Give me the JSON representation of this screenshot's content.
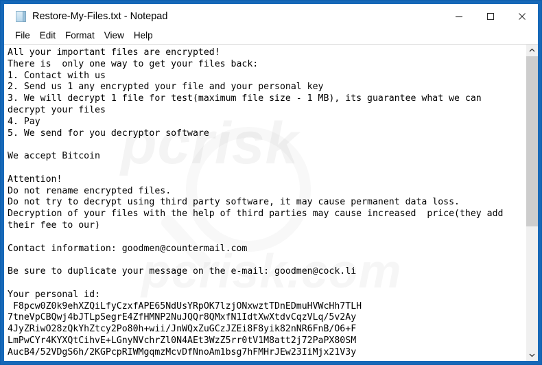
{
  "window": {
    "title": "Restore-My-Files.txt - Notepad",
    "icon": "notepad-document-icon",
    "accent_color": "#1668b8",
    "client_background": "#ffffff"
  },
  "caption_buttons": [
    {
      "name": "minimize",
      "glyph": "—",
      "label": "Minimize"
    },
    {
      "name": "maximize",
      "glyph": "□",
      "label": "Maximize"
    },
    {
      "name": "close",
      "glyph": "✕",
      "label": "Close"
    }
  ],
  "menubar": {
    "items": [
      {
        "label": "File"
      },
      {
        "label": "Edit"
      },
      {
        "label": "Format"
      },
      {
        "label": "View"
      },
      {
        "label": "Help"
      }
    ]
  },
  "document": {
    "filename": "Restore-My-Files.txt",
    "lines": [
      "All your important files are encrypted!",
      "There is  only one way to get your files back:",
      "1. Contact with us",
      "2. Send us 1 any encrypted your file and your personal key",
      "3. We will decrypt 1 file for test(maximum file size - 1 MB), its guarantee what we can",
      "decrypt your files",
      "4. Pay",
      "5. We send for you decryptor software",
      "",
      "We accept Bitcoin",
      "",
      "Attention!",
      "Do not rename encrypted files.",
      "Do not try to decrypt using third party software, it may cause permanent data loss.",
      "Decryption of your files with the help of third parties may cause increased  price(they add",
      "their fee to our)",
      "",
      "Contact information: goodmen@countermail.com",
      "",
      "Be sure to duplicate your message on the e-mail: goodmen@cock.li",
      "",
      "Your personal id:",
      " F8pcw0Z0k9ehXZQiLfyCzxfAPE65NdUsYRpOK7lzjONxwztTDnEDmuHVWcHh7TLH",
      "7tneVpCBQwj4bJTLpSegrE4ZfHMNP2NuJQQr8QMxfN1IdtXwXtdvCqzVLq/5v2Ay",
      "4JyZRiwO28zQkYhZtcy2Po80h+wii/JnWQxZuGCzJZEi8F8yik82nNR6FnB/O6+F",
      "LmPwCYr4KYXQtCihvE+LGnyNVchrZl0N4AEt3WzZ5rr0tV1M8att2j72PaPX80SM",
      "AucB4/52VDgS6h/2KGPcpRIWMgqmzMcvDfNnoAm1bsg7hFMHrJEw23IiMjx21V3y"
    ],
    "contact_email_primary": "goodmen@countermail.com",
    "contact_email_secondary": "goodmen@cock.li",
    "payment_method": "Bitcoin"
  },
  "watermark": {
    "line1": "pcrisk",
    "line2": "pcrisk.com"
  },
  "scrollbar": {
    "up_arrow": "˄",
    "down_arrow": "˅",
    "thumb_position_percent": 0,
    "thumb_size_percent": 58
  }
}
